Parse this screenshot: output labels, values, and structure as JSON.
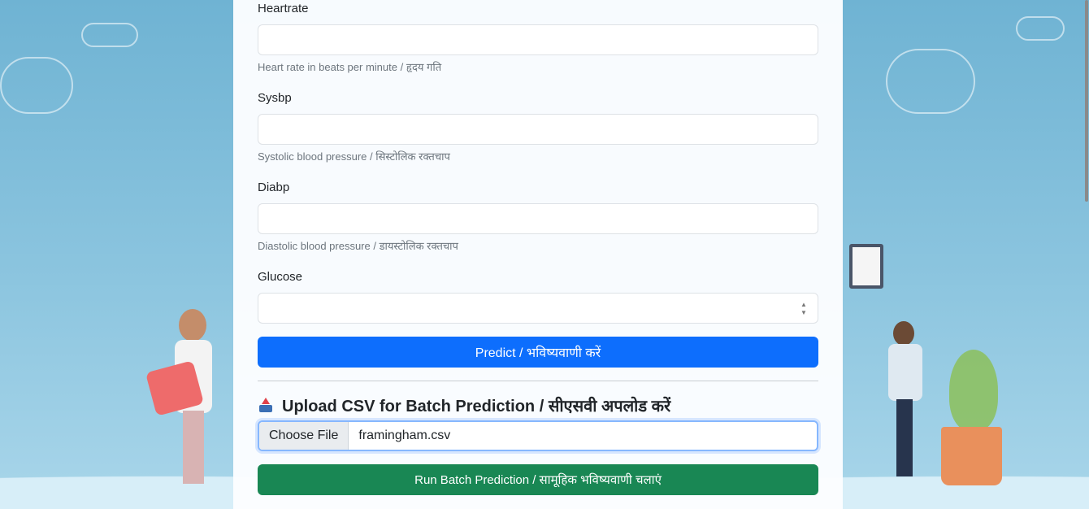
{
  "fields": [
    {
      "label": "Heartrate",
      "help": "Heart rate in beats per minute / हृदय गति",
      "value": "",
      "type": "text"
    },
    {
      "label": "Sysbp",
      "help": "Systolic blood pressure / सिस्टोलिक रक्तचाप",
      "value": "",
      "type": "text"
    },
    {
      "label": "Diabp",
      "help": "Diastolic blood pressure / डायस्टोलिक रक्तचाप",
      "value": "",
      "type": "text"
    },
    {
      "label": "Glucose",
      "help": "",
      "value": "",
      "type": "number"
    }
  ],
  "predict_button": "Predict / भविष्यवाणी करें",
  "upload": {
    "title": "Upload CSV for Batch Prediction / सीएसवी अपलोड करें",
    "icon": "upload-tray-icon",
    "choose_file_label": "Choose File",
    "file_name": "framingham.csv"
  },
  "batch_button": "Run Batch Prediction / सामूहिक भविष्यवाणी चलाएं",
  "colors": {
    "primary": "#0d6efd",
    "success": "#198754",
    "background": "#8cc5df"
  }
}
